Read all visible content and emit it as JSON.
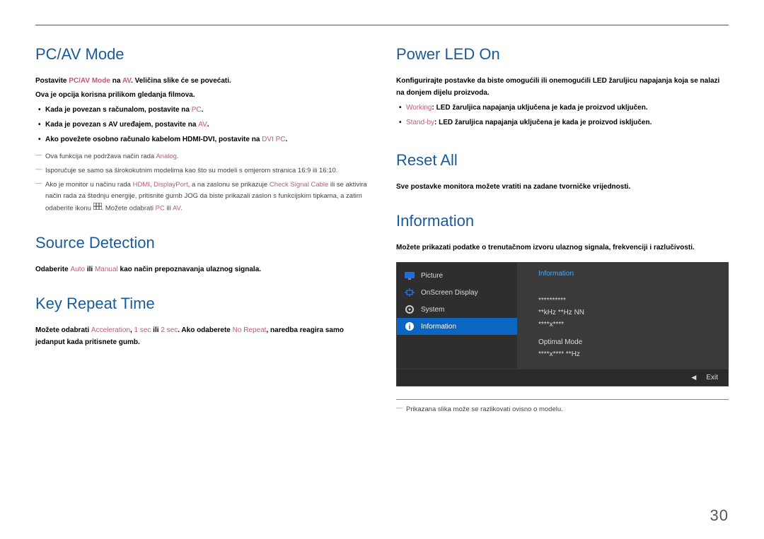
{
  "left": {
    "s1": {
      "heading": "PC/AV Mode",
      "p1a": "Postavite ",
      "p1b": "PC/AV Mode",
      "p1c": " na ",
      "p1d": "AV",
      "p1e": ". Veličina slike će se povećati.",
      "p2": "Ova je opcija korisna prilikom gledanja filmova.",
      "b1a": "Kada je povezan s računalom, postavite na ",
      "b1b": "PC",
      "b1c": ".",
      "b2a": "Kada je povezan s AV uređajem, postavite na ",
      "b2b": "AV",
      "b2c": ".",
      "b3a": "Ako povežete osobno računalo kabelom HDMI-DVI, postavite na ",
      "b3b": "DVI PC",
      "b3c": ".",
      "n1a": "Ova funkcija ne podržava način rada ",
      "n1b": "Analog",
      "n1c": ".",
      "n2": "Isporučuje se samo sa širokokutnim modelima kao što su modeli s omjerom stranica 16:9 ili 16:10.",
      "n3a": "Ako je monitor u načinu rada ",
      "n3b": "HDMI",
      "n3c": ", ",
      "n3d": "DisplayPort",
      "n3e": ", a na zaslonu se prikazuje ",
      "n3f": "Check Signal Cable",
      "n3g": " ili se aktivira način rada za štednju energije, pritisnite gumb JOG da biste prikazali zaslon s funkcijskim tipkama, a zatim odaberite ikonu ",
      "n3h": ". Možete odabrati ",
      "n3i": "PC",
      "n3j": " ili ",
      "n3k": "AV",
      "n3l": "."
    },
    "s2": {
      "heading": "Source Detection",
      "p1a": "Odaberite ",
      "p1b": "Auto",
      "p1c": " ili ",
      "p1d": "Manual",
      "p1e": " kao način prepoznavanja ulaznog signala."
    },
    "s3": {
      "heading": "Key Repeat Time",
      "p1a": "Možete odabrati ",
      "p1b": "Acceleration",
      "p1c": ", ",
      "p1d": "1 sec",
      "p1e": " ili ",
      "p1f": "2 sec",
      "p1g": ". Ako odaberete ",
      "p1h": "No Repeat",
      "p1i": ", naredba reagira samo jedanput kada pritisnete gumb."
    }
  },
  "right": {
    "s1": {
      "heading": "Power LED On",
      "p1": "Konfigurirajte postavke da biste omogućili ili onemogućili LED žaruljicu napajanja koja se nalazi na donjem dijelu proizvoda.",
      "b1a": "Working",
      "b1b": ": LED žaruljica napajanja uključena je kada je proizvod uključen.",
      "b2a": "Stand-by",
      "b2b": ": LED žaruljica napajanja uključena je kada je proizvod isključen."
    },
    "s2": {
      "heading": "Reset All",
      "p1": "Sve postavke monitora možete vratiti na zadane tvorničke vrijednosti."
    },
    "s3": {
      "heading": "Information",
      "p1": "Možete prikazati podatke o trenutačnom izvoru ulaznog signala, frekvenciji i razlučivosti."
    },
    "osd": {
      "menu": {
        "picture": "Picture",
        "onscreen": "OnScreen Display",
        "system": "System",
        "information": "Information"
      },
      "panel": {
        "title": "Information",
        "l1": "**********",
        "l2": "**kHz  **Hz  NN",
        "l3": "****x****",
        "l4": "Optimal Mode",
        "l5": "****x****  **Hz"
      },
      "exit": "Exit"
    },
    "footnote": "Prikazana slika može se razlikovati ovisno o modelu."
  },
  "page": "30"
}
